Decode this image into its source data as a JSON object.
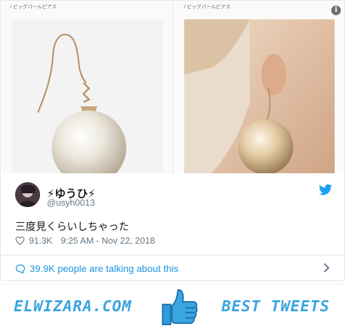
{
  "images": {
    "left_caption": "/ ビッグパールピアス",
    "right_caption": "/ ビッグパールピアス"
  },
  "author": {
    "display_name": "⚡ゆうひ⚡",
    "handle": "@usyh0013"
  },
  "tweet": {
    "text": "三度見くらいしちゃった",
    "likes": "91.3K",
    "timestamp": "9:25 AM - Nov 22, 2018"
  },
  "conversation": {
    "label": "39.9K people are talking about this"
  },
  "banner": {
    "site": "ELWIZARA.COM",
    "tagline": "BEST TWEETS"
  },
  "colors": {
    "twitter_blue": "#1da1f2",
    "link_blue": "#1b95e0",
    "banner_blue": "#3aa5e0"
  }
}
